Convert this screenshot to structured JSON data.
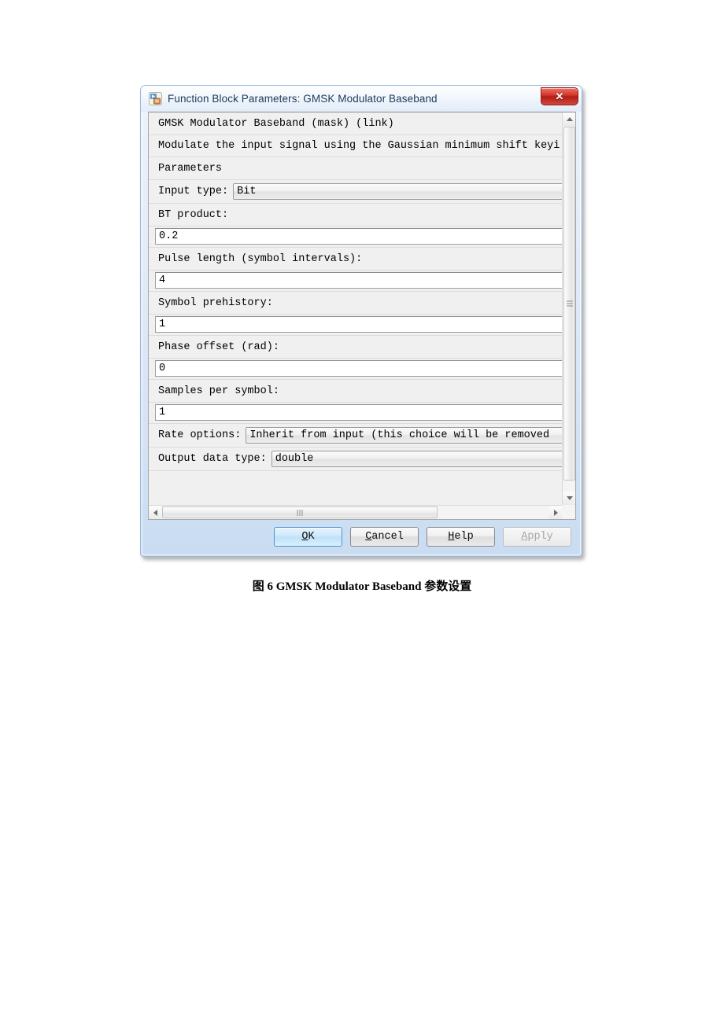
{
  "window": {
    "title": "Function Block Parameters: GMSK Modulator Baseband",
    "icon": "simulink-block-icon",
    "close_label": "✕",
    "accent_color": "#b31d15",
    "frame_color": "#c9dcf2"
  },
  "mask": {
    "header": "GMSK Modulator Baseband (mask) (link)",
    "description": "Modulate the input signal using the Gaussian minimum shift keyi",
    "section_title": "Parameters"
  },
  "params": {
    "input_type": {
      "label": "Input type:",
      "value": "Bit",
      "control": "combo"
    },
    "bt_product": {
      "label": "BT product:",
      "value": "0.2",
      "control": "text"
    },
    "pulse_length": {
      "label": "Pulse length (symbol intervals):",
      "value": "4",
      "control": "text"
    },
    "symbol_prehistory": {
      "label": "Symbol prehistory:",
      "value": "1",
      "control": "text"
    },
    "phase_offset": {
      "label": "Phase offset (rad):",
      "value": "0",
      "control": "text"
    },
    "samples_per_symbol": {
      "label": "Samples per symbol:",
      "value": "1",
      "control": "text"
    },
    "rate_options": {
      "label": "Rate options:",
      "value": "Inherit from input (this choice will be removed ",
      "control": "combo"
    },
    "output_data_type": {
      "label": "Output data type:",
      "value": "double",
      "control": "combo"
    }
  },
  "buttons": {
    "ok": {
      "mnemonic": "O",
      "rest": "K",
      "state": "default"
    },
    "cancel": {
      "mnemonic": "C",
      "rest": "ancel",
      "state": "normal"
    },
    "help": {
      "mnemonic": "H",
      "rest": "elp",
      "state": "normal"
    },
    "apply": {
      "mnemonic": "A",
      "rest": "pply",
      "state": "disabled"
    }
  },
  "scrollbars": {
    "vertical": {
      "up": "▲",
      "down": "▼"
    },
    "horizontal": {
      "left": "◀",
      "right": "▶"
    }
  },
  "caption": {
    "text": "图 6 GMSK Modulator Baseband 参数设置"
  }
}
